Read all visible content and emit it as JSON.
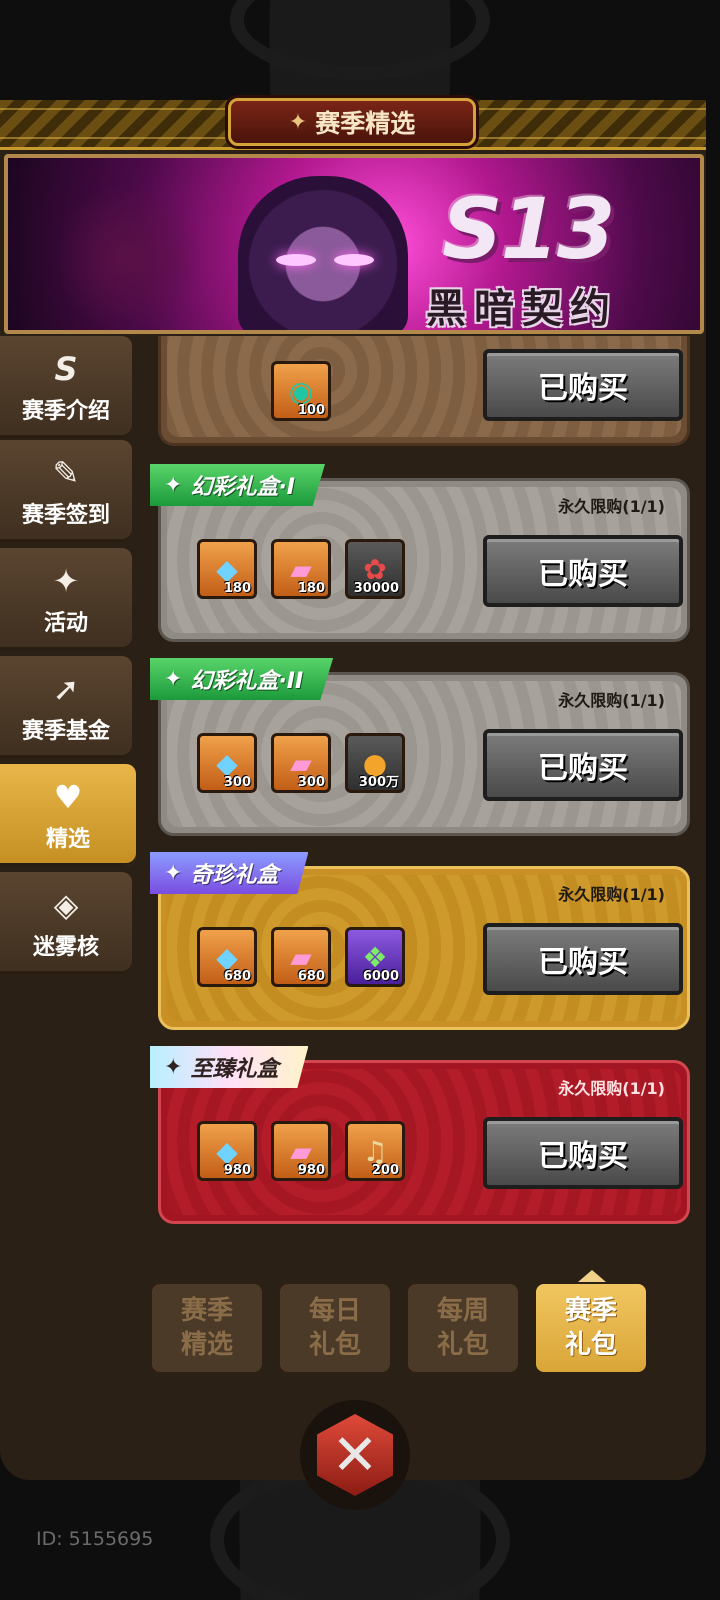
{
  "header": {
    "title": "赛季精选",
    "title_icon": "season-spark-icon"
  },
  "banner": {
    "season": "S13",
    "subtitle": "黑暗契约"
  },
  "sidebar": {
    "items": [
      {
        "label": "赛季介绍",
        "icon": "season-s-icon",
        "glyph": "S"
      },
      {
        "label": "赛季签到",
        "icon": "checkin-sword-icon",
        "glyph": "✎"
      },
      {
        "label": "活动",
        "icon": "gift-sparkle-icon",
        "glyph": "✦"
      },
      {
        "label": "赛季基金",
        "icon": "fund-arrow-icon",
        "glyph": "➚"
      },
      {
        "label": "精选",
        "icon": "heart-icon",
        "glyph": "♥"
      },
      {
        "label": "迷雾核",
        "icon": "fog-core-icon",
        "glyph": "◈"
      }
    ],
    "active_index": 4
  },
  "packs": [
    {
      "name": "",
      "limit": "",
      "items": [
        {
          "icon": "teal-gem-icon",
          "qty": "100"
        }
      ],
      "button": "已购买"
    },
    {
      "name": "幻彩礼盒·I",
      "limit": "永久限购(1/1)",
      "items": [
        {
          "icon": "diamond-icon",
          "qty": "180"
        },
        {
          "icon": "card-pack-icon",
          "qty": "180"
        },
        {
          "icon": "flower-icon",
          "qty": "30000"
        }
      ],
      "button": "已购买"
    },
    {
      "name": "幻彩礼盒·II",
      "limit": "永久限购(1/1)",
      "items": [
        {
          "icon": "diamond-icon",
          "qty": "300"
        },
        {
          "icon": "card-pack-icon",
          "qty": "300"
        },
        {
          "icon": "gold-coin-icon",
          "qty": "300万"
        }
      ],
      "button": "已购买"
    },
    {
      "name": "奇珍礼盒",
      "limit": "永久限购(1/1)",
      "items": [
        {
          "icon": "diamond-icon",
          "qty": "680"
        },
        {
          "icon": "card-pack-icon",
          "qty": "680"
        },
        {
          "icon": "green-crystal-icon",
          "qty": "6000"
        }
      ],
      "button": "已购买"
    },
    {
      "name": "至臻礼盒",
      "limit": "永久限购(1/1)",
      "items": [
        {
          "icon": "diamond-icon",
          "qty": "980"
        },
        {
          "icon": "card-pack-icon",
          "qty": "980"
        },
        {
          "icon": "bell-icon",
          "qty": "200"
        }
      ],
      "button": "已购买"
    }
  ],
  "tabs": [
    {
      "line1": "赛季",
      "line2": "精选"
    },
    {
      "line1": "每日",
      "line2": "礼包"
    },
    {
      "line1": "每周",
      "line2": "礼包"
    },
    {
      "line1": "赛季",
      "line2": "礼包"
    }
  ],
  "active_tab": 3,
  "close_icon": "close-x-icon",
  "footer": {
    "user_id": "ID: 5155695"
  },
  "colors": {
    "accent_gold": "#e8b64a",
    "panel_brown": "#2a2015",
    "ribbon_green": "#1c9a3b",
    "ribbon_purple": "#7b4de0",
    "card_red": "#a31522"
  }
}
